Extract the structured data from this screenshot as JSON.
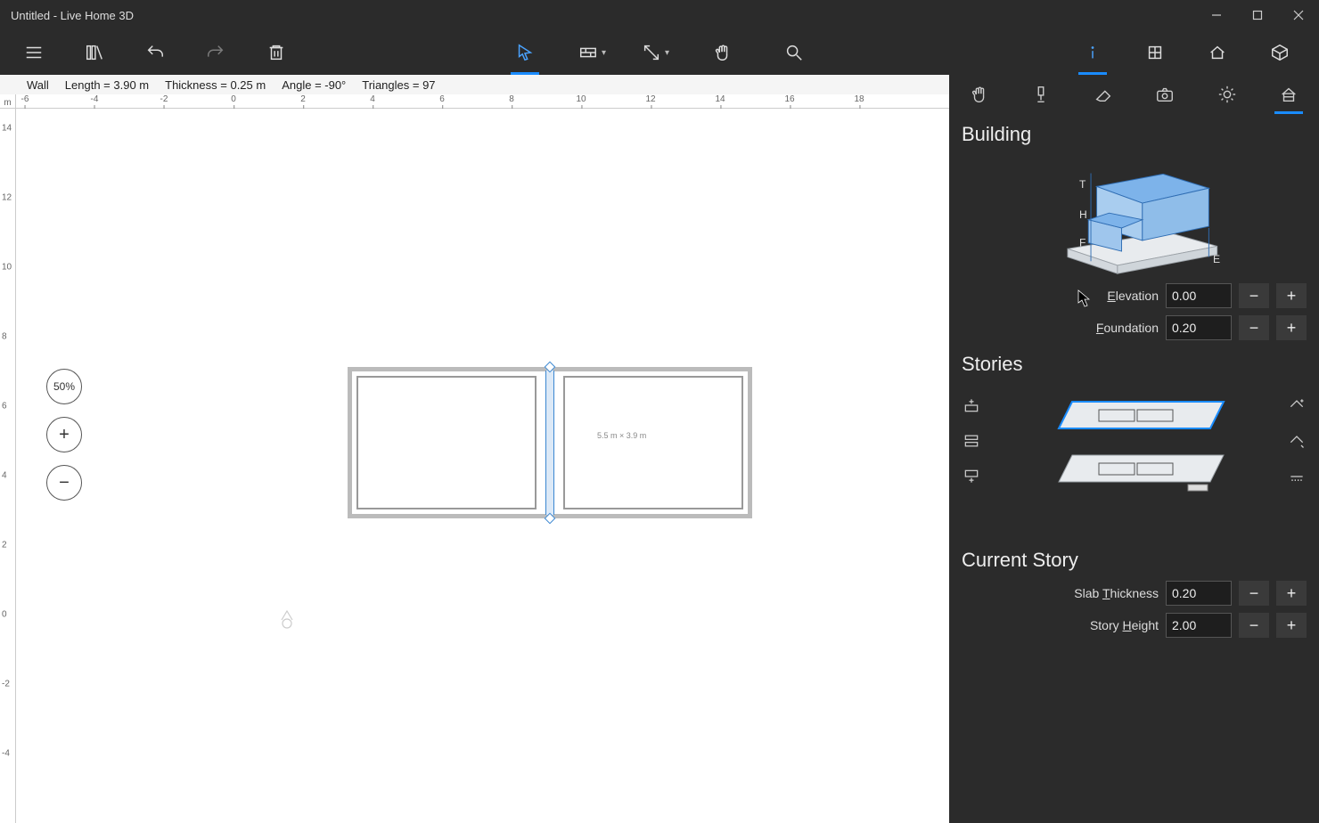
{
  "titlebar": {
    "title": "Untitled - Live Home 3D"
  },
  "statusbar": {
    "object": "Wall",
    "length": "Length = 3.90 m",
    "thickness": "Thickness = 0.25 m",
    "angle": "Angle = -90°",
    "triangles": "Triangles = 97"
  },
  "ruler_h": {
    "unit": "m",
    "ticks": [
      "-6",
      "-4",
      "-2",
      "0",
      "2",
      "4",
      "6",
      "8",
      "10",
      "12",
      "14",
      "16",
      "18"
    ]
  },
  "ruler_v": {
    "ticks": [
      "14",
      "12",
      "10",
      "8",
      "6",
      "4",
      "2",
      "0",
      "-2",
      "-4"
    ]
  },
  "zoom": {
    "percent": "50%",
    "plus": "+",
    "minus": "−"
  },
  "plan": {
    "dims": "5.5 m × 3.9 m"
  },
  "panel": {
    "building_title": "Building",
    "diagram_labels": {
      "T": "T",
      "H": "H",
      "F": "F",
      "E": "E"
    },
    "elevation_label": "Elevation",
    "foundation_label": "Foundation",
    "elevation_value": "0.00",
    "foundation_value": "0.20",
    "stories_title": "Stories",
    "current_story_title": "Current Story",
    "slab_label": "Slab Thickness",
    "slab_value": "0.20",
    "story_height_label": "Story Height",
    "story_height_value": "2.00",
    "minus": "−",
    "plus": "+"
  },
  "icons": {
    "hamburger": "hamburger-icon",
    "library": "library-icon",
    "undo": "undo-icon",
    "redo": "redo-icon",
    "trash": "trash-icon",
    "pointer": "pointer-icon",
    "wall_tool": "wall-tool-icon",
    "dimension_tool": "dimension-tool-icon",
    "pan": "pan-hand-icon",
    "search": "search-icon",
    "info_tab": "info-tab-icon",
    "room_tab": "room-tab-icon",
    "house_tab": "house-tab-icon",
    "cube_tab": "cube-tab-icon",
    "hand_panel": "hand-icon",
    "paint": "paint-roller-icon",
    "eraser": "eraser-icon",
    "camera": "camera-icon",
    "sun": "sun-icon",
    "building_panel": "building-panel-icon"
  }
}
